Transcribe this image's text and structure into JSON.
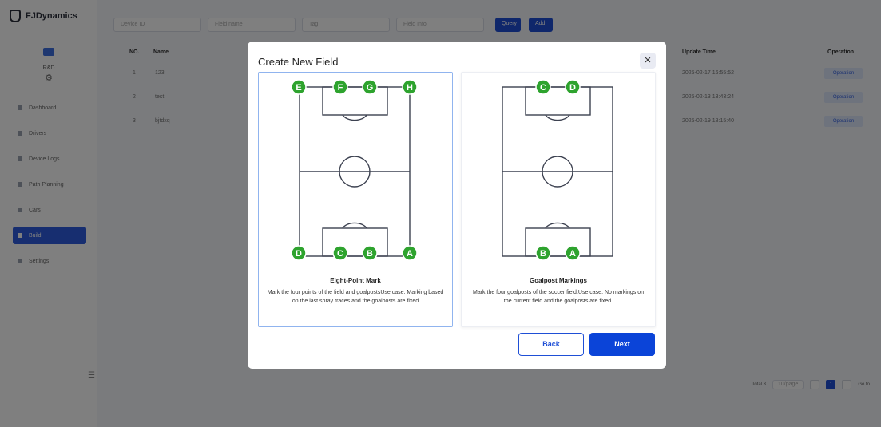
{
  "app": {
    "brand": "FJDynamics",
    "user_name": "R&D",
    "menu": [
      "Dashboard",
      "Drivers",
      "Device Logs",
      "Path Planning",
      "Cars",
      "Build",
      "Settings"
    ]
  },
  "toolbar": {
    "filters": [
      "Device ID",
      "Field name",
      "Tag",
      "Field Info"
    ],
    "query_label": "Query",
    "add_label": "Add"
  },
  "table": {
    "headers": {
      "no": "NO.",
      "name": "Name",
      "update_time": "Update Time",
      "operation": "Operation"
    },
    "rows": [
      {
        "no": "1",
        "name": "123",
        "update_time": "2025-02-17 16:55:52",
        "op": "Operation"
      },
      {
        "no": "2",
        "name": "test",
        "update_time": "2025-02-13 13:43:24",
        "op": "Operation"
      },
      {
        "no": "3",
        "name": "bjtdxq",
        "update_time": "2025-02-19 18:15:40",
        "op": "Operation"
      }
    ]
  },
  "pagination": {
    "total": "Total 3",
    "page_size": "10/page",
    "current": "1",
    "goto": "Go to"
  },
  "dialog": {
    "title": "Create New Field",
    "close_icon": "×",
    "cards": [
      {
        "title": "Eight-Point Mark",
        "desc": "Mark the four points of the field and goalpostsUse case: Marking based on the last spray traces and the goalposts are fixed",
        "markers": [
          "E",
          "F",
          "G",
          "H",
          "D",
          "C",
          "B",
          "A"
        ],
        "selected": true
      },
      {
        "title": "Goalpost Markings",
        "desc": "Mark the four goalposts of the soccer field.Use case: No markings on the current field and the goalposts are fixed.",
        "markers": [
          "C",
          "D",
          "B",
          "A"
        ],
        "selected": false
      }
    ],
    "back_label": "Back",
    "next_label": "Next"
  },
  "colors": {
    "marker": "#2ea32e",
    "primary": "#0b44d8",
    "selected_border": "#90b4ef",
    "field_line": "#3c4150"
  }
}
